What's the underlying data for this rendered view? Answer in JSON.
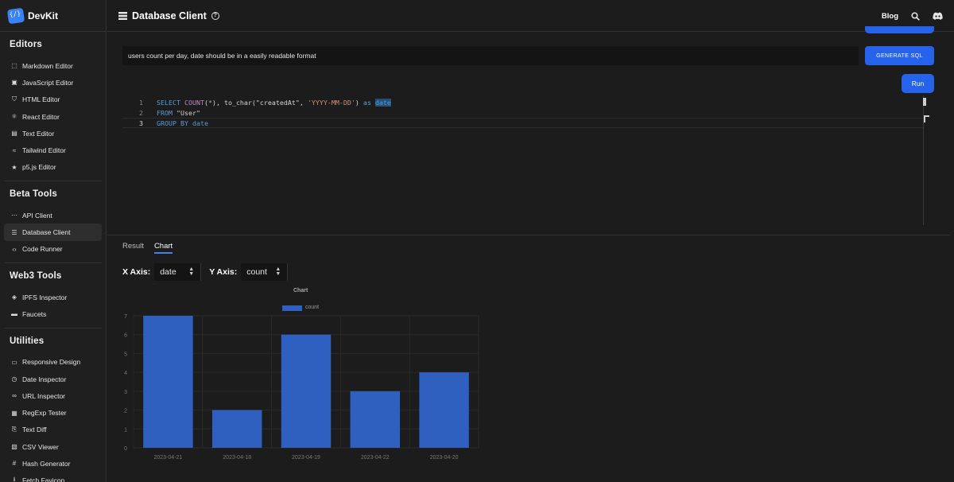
{
  "brand": {
    "name": "DevKit",
    "logo_icon": "braces-logo-icon"
  },
  "sidebar": {
    "sections": [
      {
        "title": "Editors",
        "items": [
          {
            "label": "Markdown Editor",
            "icon": "markdown-icon",
            "glyph": "⬚"
          },
          {
            "label": "JavaScript Editor",
            "icon": "javascript-icon",
            "glyph": "▣"
          },
          {
            "label": "HTML Editor",
            "icon": "html-icon",
            "glyph": "⛉"
          },
          {
            "label": "React Editor",
            "icon": "react-icon",
            "glyph": "⚛"
          },
          {
            "label": "Text Editor",
            "icon": "text-file-icon",
            "glyph": "▤"
          },
          {
            "label": "Tailwind Editor",
            "icon": "tailwind-icon",
            "glyph": "≈"
          },
          {
            "label": "p5.js Editor",
            "icon": "star-icon",
            "glyph": "★"
          }
        ]
      },
      {
        "title": "Beta Tools",
        "items": [
          {
            "label": "API Client",
            "icon": "api-icon",
            "glyph": "⋯"
          },
          {
            "label": "Database Client",
            "icon": "database-icon",
            "glyph": "☰",
            "active": true
          },
          {
            "label": "Code Runner",
            "icon": "code-icon",
            "glyph": "‹›"
          }
        ]
      },
      {
        "title": "Web3 Tools",
        "items": [
          {
            "label": "IPFS Inspector",
            "icon": "cube-icon",
            "glyph": "◈"
          },
          {
            "label": "Faucets",
            "icon": "faucet-icon",
            "glyph": "▬"
          }
        ]
      },
      {
        "title": "Utilities",
        "items": [
          {
            "label": "Responsive Design",
            "icon": "devices-icon",
            "glyph": "▭"
          },
          {
            "label": "Date Inspector",
            "icon": "clock-icon",
            "glyph": "◷"
          },
          {
            "label": "URL Inspector",
            "icon": "link-icon",
            "glyph": "∞"
          },
          {
            "label": "RegExp Tester",
            "icon": "regex-icon",
            "glyph": "▦"
          },
          {
            "label": "Text Diff",
            "icon": "diff-icon",
            "glyph": "⎘"
          },
          {
            "label": "CSV Viewer",
            "icon": "csv-icon",
            "glyph": "▧"
          },
          {
            "label": "Hash Generator",
            "icon": "hash-icon",
            "glyph": "#"
          },
          {
            "label": "Fetch Favicon",
            "icon": "download-icon",
            "glyph": "⭳"
          }
        ]
      }
    ]
  },
  "header": {
    "title": "Database Client",
    "title_icon": "database-icon",
    "help_icon": "question-circle-icon",
    "blog_label": "Blog",
    "search_icon": "search-icon",
    "discord_icon": "discord-icon"
  },
  "query": {
    "prompt_value": "users count per day, date should be in a easily readable format",
    "generate_label": "GENERATE SQL",
    "run_label": "Run"
  },
  "editor": {
    "line_numbers": [
      "1",
      "2",
      "3"
    ],
    "current_line": 3
  },
  "tabs": [
    {
      "label": "Result",
      "active": false
    },
    {
      "label": "Chart",
      "active": true
    }
  ],
  "axes": {
    "x_label": "X Axis:",
    "x_value": "date",
    "y_label": "Y Axis:",
    "y_value": "count"
  },
  "colors": {
    "accent": "#2563eb",
    "bar": "#2f5fbf",
    "background": "#1c1c1c"
  },
  "chart_data": {
    "type": "bar",
    "title": "Chart",
    "categories": [
      "2023-04-21",
      "2023-04-18",
      "2023-04-19",
      "2023-04-22",
      "2023-04-20"
    ],
    "series": [
      {
        "name": "count",
        "values": [
          7,
          2,
          6,
          3,
          4
        ]
      }
    ],
    "ylim": [
      0,
      7
    ],
    "yticks": [
      0,
      1,
      2,
      3,
      4,
      5,
      6,
      7
    ],
    "grid": true,
    "legend": "top-center"
  }
}
